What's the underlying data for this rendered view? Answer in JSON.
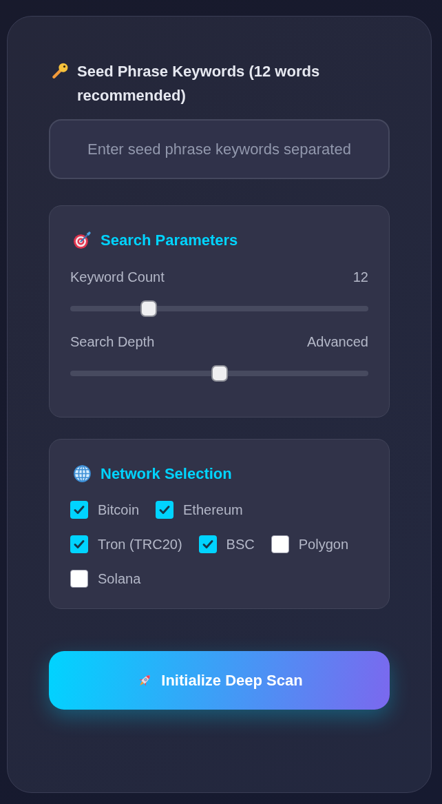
{
  "seed_phrase": {
    "label": "Seed Phrase Keywords (12 words recommended)",
    "placeholder": "Enter seed phrase keywords separated"
  },
  "search_parameters": {
    "title": "Search Parameters",
    "sliders": [
      {
        "label": "Keyword Count",
        "reading": "12",
        "level": 0.25
      },
      {
        "label": "Search Depth",
        "reading": "Advanced",
        "level": 0.5
      }
    ]
  },
  "network_selection": {
    "title": "Network Selection",
    "networks": [
      {
        "label": "Bitcoin",
        "checked": true
      },
      {
        "label": "Ethereum",
        "checked": true
      },
      {
        "label": "Tron (TRC20)",
        "checked": true
      },
      {
        "label": "BSC",
        "checked": true
      },
      {
        "label": "Polygon",
        "checked": false
      },
      {
        "label": "Solana",
        "checked": false
      }
    ]
  },
  "scan_button": {
    "label": "Initialize Deep Scan"
  }
}
